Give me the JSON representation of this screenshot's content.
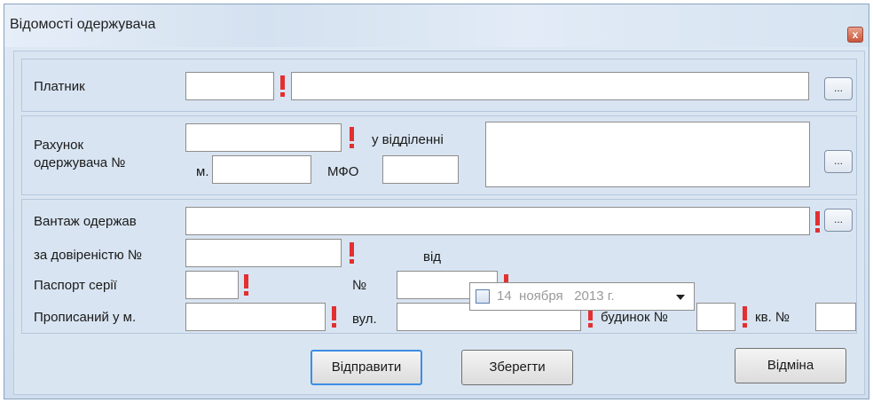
{
  "window": {
    "title": "Відомості одержувача",
    "close_glyph": "x"
  },
  "payer": {
    "label": "Платник",
    "code_value": "",
    "name_value": "",
    "browse_label": "..."
  },
  "account": {
    "label_line1": "Рахунок",
    "label_line2": "одержувача №",
    "number_value": "",
    "branch_label": "у відділенні",
    "city_prefix": "м.",
    "city_value": "",
    "mfo_label": "МФО",
    "mfo_value": "",
    "branch_value": "",
    "browse_label": "..."
  },
  "cargo": {
    "received_label": "Вантаж одержав",
    "received_value": "",
    "browse_label": "...",
    "proxy_label": "за довіреністю №",
    "proxy_value": "",
    "from_label": "від",
    "date_day": "14",
    "date_month": "ноября",
    "date_year": "2013 г.",
    "passport_series_label": "Паспорт серії",
    "passport_series_value": "",
    "passport_number_label": "№",
    "passport_number_value": "",
    "registered_label": "Прописаний у м.",
    "registered_city_value": "",
    "street_label": "вул.",
    "street_value": "",
    "house_label": "будинок №",
    "house_value": "",
    "apartment_label": "кв. №",
    "apartment_value": ""
  },
  "buttons": {
    "send": "Відправити",
    "save": "Зберегти",
    "cancel": "Відміна"
  },
  "colors": {
    "required_mark": "#e23030",
    "default_button_border": "#3d8ee3",
    "client_bg": "#dae5f2"
  }
}
